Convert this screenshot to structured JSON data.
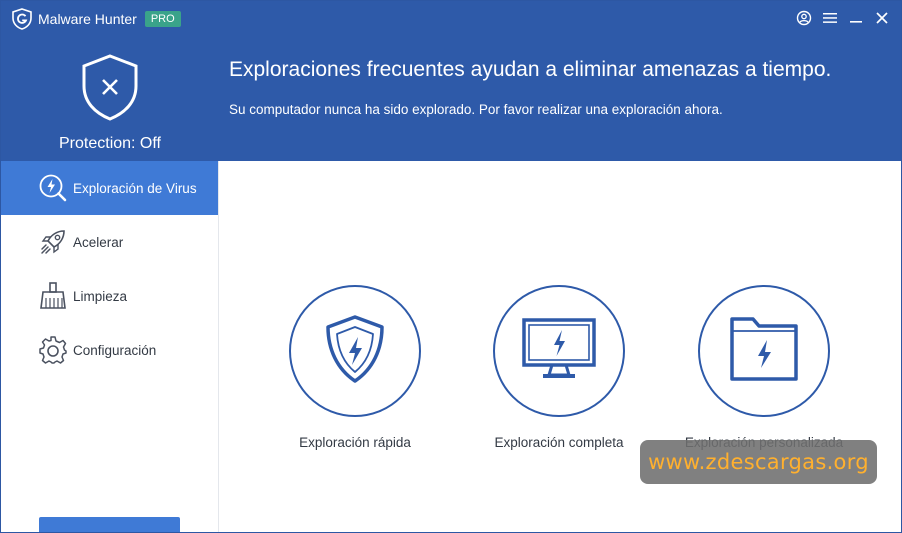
{
  "app": {
    "name": "Malware Hunter",
    "badge": "PRO",
    "icons": {
      "logo": "shield-g-logo-icon",
      "account": "user-circle-icon",
      "menu": "hamburger-menu-icon",
      "minimize": "minimize-icon",
      "close": "close-icon"
    }
  },
  "header": {
    "protection_label": "Protection: Off",
    "protection_icon": "shield-x-icon",
    "headline": "Exploraciones frecuentes ayudan a eliminar amenazas a tiempo.",
    "subline": "Su computador nunca ha sido explorado. Por favor realizar una exploración ahora."
  },
  "sidebar": {
    "items": [
      {
        "label": "Exploración de Virus",
        "icon": "lightning-search-icon",
        "active": true
      },
      {
        "label": "Acelerar",
        "icon": "rocket-icon",
        "active": false
      },
      {
        "label": "Limpieza",
        "icon": "broom-icon",
        "active": false
      },
      {
        "label": "Configuración",
        "icon": "gear-icon",
        "active": false
      }
    ]
  },
  "main": {
    "options": [
      {
        "label": "Exploración rápida",
        "icon": "shield-lightning-icon"
      },
      {
        "label": "Exploración completa",
        "icon": "monitor-lightning-icon"
      },
      {
        "label": "Exploración personalizada",
        "icon": "folder-lightning-icon"
      }
    ]
  },
  "watermark": {
    "text": "www.zdescargas.org"
  },
  "colors": {
    "header_blue": "#2e5aa9",
    "active_blue": "#3f7ad6",
    "pro_green": "#3aa38a",
    "watermark_orange": "#ffb02e"
  }
}
